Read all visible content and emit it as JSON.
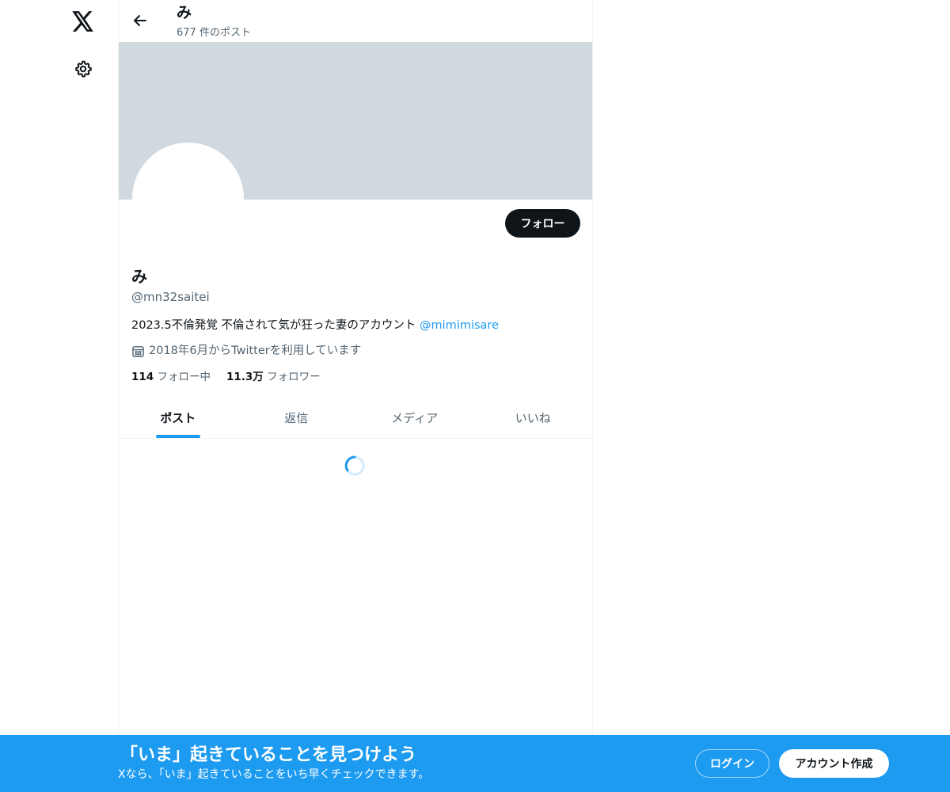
{
  "nav": {
    "logo_icon": "x-logo-icon",
    "settings_icon": "gear-icon"
  },
  "header": {
    "back_icon": "arrow-left-icon",
    "name": "み",
    "post_count": "677 件のポスト"
  },
  "profile": {
    "follow_label": "フォロー",
    "display_name": "み",
    "handle": "@mn32saitei",
    "bio_text": "2023.5不倫発覚 不倫されて気が狂った妻のアカウント ",
    "bio_link": "@mimimisare",
    "joined_icon": "calendar-icon",
    "joined": "2018年6月からTwitterを利用しています",
    "following_count": "114",
    "following_label": "フォロー中",
    "followers_count": "11.3万",
    "followers_label": "フォロワー"
  },
  "tabs": [
    {
      "label": "ポスト",
      "active": true
    },
    {
      "label": "返信",
      "active": false
    },
    {
      "label": "メディア",
      "active": false
    },
    {
      "label": "いいね",
      "active": false
    }
  ],
  "bottom_bar": {
    "title": "「いま」起きていることを見つけよう",
    "subtitle": "Xなら、「いま」起きていることをいち早くチェックできます。",
    "login_label": "ログイン",
    "signup_label": "アカウント作成"
  },
  "colors": {
    "accent": "#1d9bf0",
    "banner": "#cfd9de",
    "text": "#0f1419",
    "muted": "#536471"
  }
}
